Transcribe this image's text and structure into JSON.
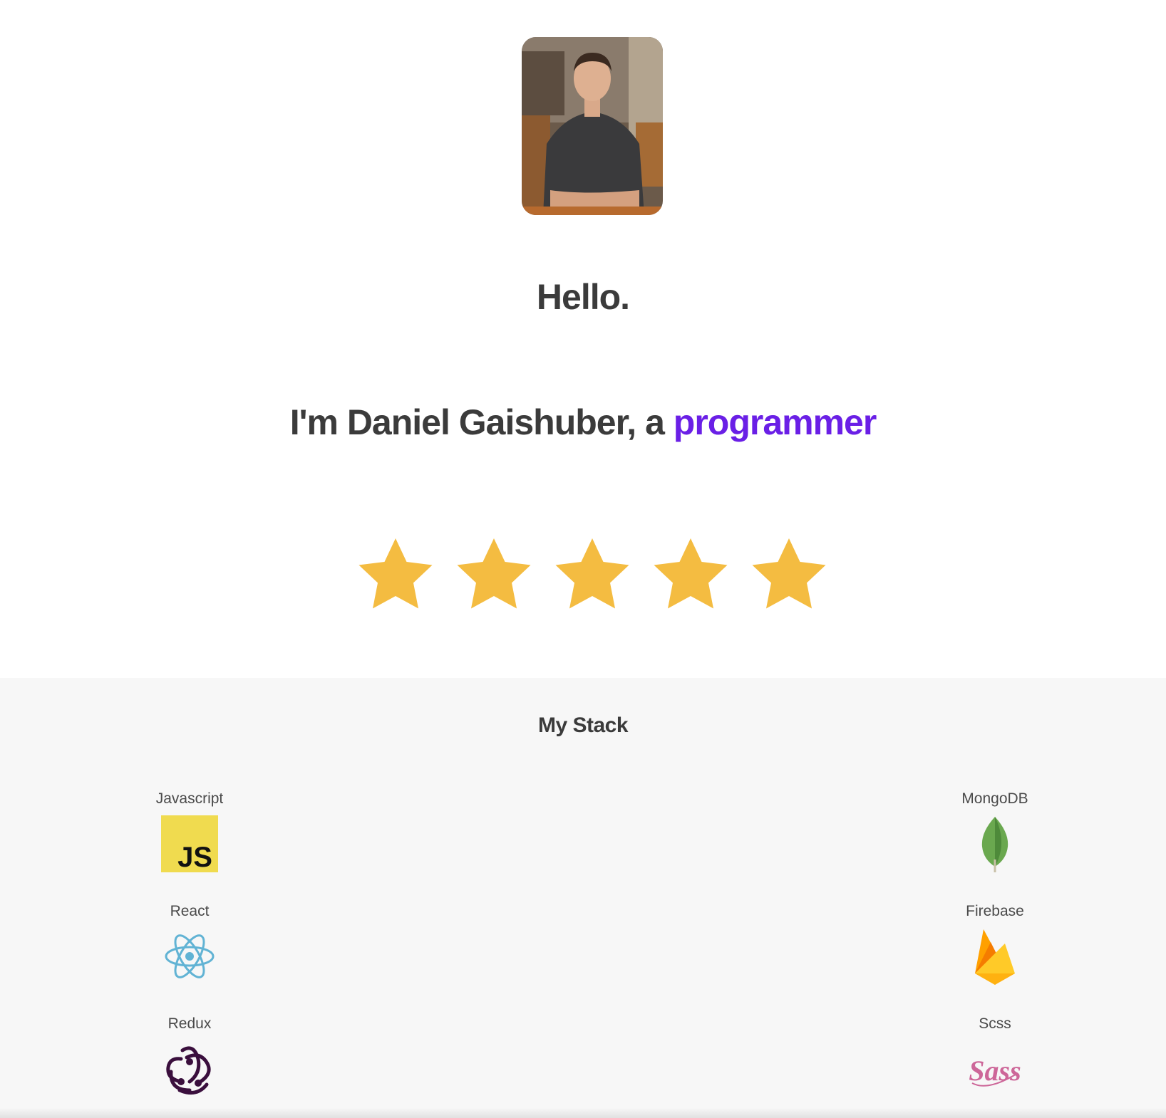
{
  "hero": {
    "greeting": "Hello.",
    "intro_prefix": "I'm Daniel Gaishuber, a ",
    "intro_role": "programmer",
    "role_color": "#6a1fe6",
    "rating": {
      "value": 5,
      "max": 5,
      "star_color": "#f4bc41"
    }
  },
  "stack": {
    "title": "My Stack",
    "left": [
      {
        "label": "Javascript",
        "icon": "javascript-logo-icon"
      },
      {
        "label": "React",
        "icon": "react-logo-icon"
      },
      {
        "label": "Redux",
        "icon": "redux-logo-icon"
      }
    ],
    "right": [
      {
        "label": "MongoDB",
        "icon": "mongodb-logo-icon"
      },
      {
        "label": "Firebase",
        "icon": "firebase-logo-icon"
      },
      {
        "label": "Scss",
        "icon": "sass-logo-icon"
      }
    ]
  }
}
